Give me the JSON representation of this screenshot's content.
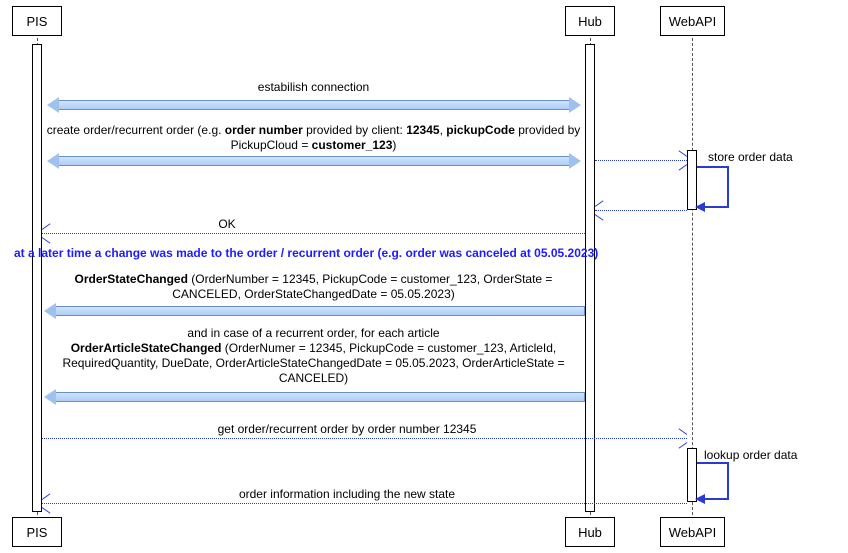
{
  "participants": {
    "pis": "PIS",
    "hub": "Hub",
    "webapi": "WebAPI"
  },
  "messages": {
    "establish": "estabilish connection",
    "create_order_l1": "create order/recurrent order (e.g. <b>order number</b> provided by client: <b>12345</b>, <b>pickupCode</b> provided by",
    "create_order_l2": "PickupCloud = <b>customer_123</b>)",
    "store_order": "store order data",
    "ok": "OK",
    "later_note": "at a later time a change was made to the order / recurrent order (e.g. order was canceled at 05.05.2023)",
    "osc_l1": "<b>OrderStateChanged</b> (OrderNumber = 12345, PickupCode = customer_123, OrderState =",
    "osc_l2": "CANCELED, OrderStateChangedDate = 05.05.2023)",
    "recurrent_intro": "and in case of a recurrent order, for each article",
    "oasc_l1": "<b>OrderArticleStateChanged</b> (OrderNumer = 12345, PickupCode = customer_123, ArticleId,",
    "oasc_l2": "RequiredQuantity, DueDate, OrderArticleStateChangedDate = 05.05.2023, OrderArticleState =",
    "oasc_l3": "CANCELED)",
    "get_order": "get order/recurrent order by order number 12345",
    "lookup": "lookup order data",
    "order_info": "order information including the new state"
  },
  "chart_data": {
    "type": "sequence-diagram",
    "participants": [
      "PIS",
      "Hub",
      "WebAPI"
    ],
    "interactions": [
      {
        "from": "PIS",
        "to": "Hub",
        "kind": "sync-bidirectional",
        "label": "estabilish connection"
      },
      {
        "from": "PIS",
        "to": "Hub",
        "kind": "sync-bidirectional",
        "label": "create order/recurrent order (e.g. order number provided by client: 12345, pickupCode provided by PickupCloud = customer_123)"
      },
      {
        "from": "Hub",
        "to": "WebAPI",
        "kind": "async-dashed",
        "label": ""
      },
      {
        "from": "WebAPI",
        "to": "WebAPI",
        "kind": "self",
        "label": "store order data"
      },
      {
        "from": "WebAPI",
        "to": "Hub",
        "kind": "async-dashed",
        "label": ""
      },
      {
        "from": "Hub",
        "to": "PIS",
        "kind": "return-dashed",
        "label": "OK"
      },
      {
        "kind": "note",
        "label": "at a later time a change was made to the order / recurrent order (e.g. order was canceled at 05.05.2023)"
      },
      {
        "from": "Hub",
        "to": "PIS",
        "kind": "sync-left",
        "label": "OrderStateChanged (OrderNumber = 12345, PickupCode = customer_123, OrderState = CANCELED, OrderStateChangedDate = 05.05.2023)"
      },
      {
        "from": "Hub",
        "to": "PIS",
        "kind": "sync-left",
        "label": "and in case of a recurrent order, for each article — OrderArticleStateChanged (OrderNumer = 12345, PickupCode = customer_123, ArticleId, RequiredQuantity, DueDate, OrderArticleStateChangedDate = 05.05.2023, OrderArticleState = CANCELED)"
      },
      {
        "from": "PIS",
        "to": "WebAPI",
        "kind": "async-dashed",
        "label": "get order/recurrent order by order number 12345"
      },
      {
        "from": "WebAPI",
        "to": "WebAPI",
        "kind": "self",
        "label": "lookup order data"
      },
      {
        "from": "WebAPI",
        "to": "PIS",
        "kind": "return-dashed",
        "label": "order information including the new state"
      }
    ]
  }
}
